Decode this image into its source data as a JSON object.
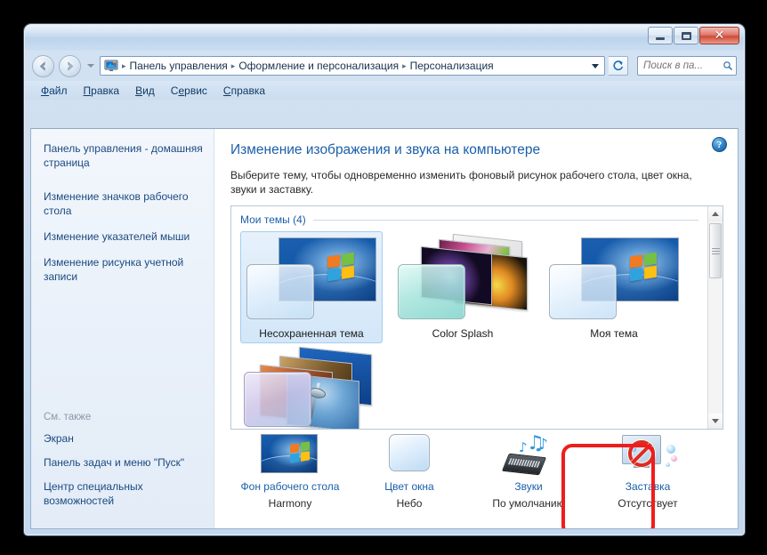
{
  "window": {
    "controls": {
      "minimize": "—",
      "maximize": "□",
      "close": "✕"
    }
  },
  "navbar": {
    "back_label": "Назад",
    "forward_label": "Вперед",
    "recent_label": "Последние страницы",
    "breadcrumb": [
      "Панель управления",
      "Оформление и персонализация",
      "Персонализация"
    ],
    "separator": "▸",
    "refresh_label": "Обновить",
    "search": {
      "value": "",
      "placeholder": "Поиск в па...",
      "icon": "search-icon"
    }
  },
  "menubar": {
    "items": [
      {
        "label": "Файл",
        "accel": "Ф"
      },
      {
        "label": "Правка",
        "accel": "П"
      },
      {
        "label": "Вид",
        "accel": "В"
      },
      {
        "label": "Сервис",
        "accel": "е"
      },
      {
        "label": "Справка",
        "accel": "С"
      }
    ]
  },
  "sidebar": {
    "home_link": "Панель управления - домашняя страница",
    "links": [
      "Изменение значков рабочего стола",
      "Изменение указателей мыши",
      "Изменение рисунка учетной записи"
    ],
    "see_also_title": "См. также",
    "see_also_links": [
      "Экран",
      "Панель задач и меню \"Пуск\"",
      "Центр специальных возможностей"
    ]
  },
  "main": {
    "help_label": "?",
    "title": "Изменение изображения и звука на компьютере",
    "description": "Выберите тему, чтобы одновременно изменить фоновый рисунок рабочего стола, цвет окна, звуки и заставку.",
    "gallery": {
      "group_title": "Мои темы (4)",
      "themes": [
        {
          "label": "Несохраненная тема",
          "selected": true
        },
        {
          "label": "Color Splash",
          "selected": false
        },
        {
          "label": "Моя тема",
          "selected": false
        }
      ]
    },
    "settings": [
      {
        "title": "Фон рабочего стола",
        "value": "Harmony",
        "icon": "desktop-background-icon",
        "highlighted": false
      },
      {
        "title": "Цвет окна",
        "value": "Небо",
        "icon": "window-color-icon",
        "highlighted": true
      },
      {
        "title": "Звуки",
        "value": "По умолчанию",
        "icon": "sounds-icon",
        "highlighted": false
      },
      {
        "title": "Заставка",
        "value": "Отсутствует",
        "icon": "screensaver-icon",
        "highlighted": false
      }
    ]
  },
  "colors": {
    "accent_link": "#1b5fa8",
    "highlight_box": "#ee1d1d",
    "title_text": "#1b5fa8",
    "window_chrome": "#c3d8ee"
  }
}
